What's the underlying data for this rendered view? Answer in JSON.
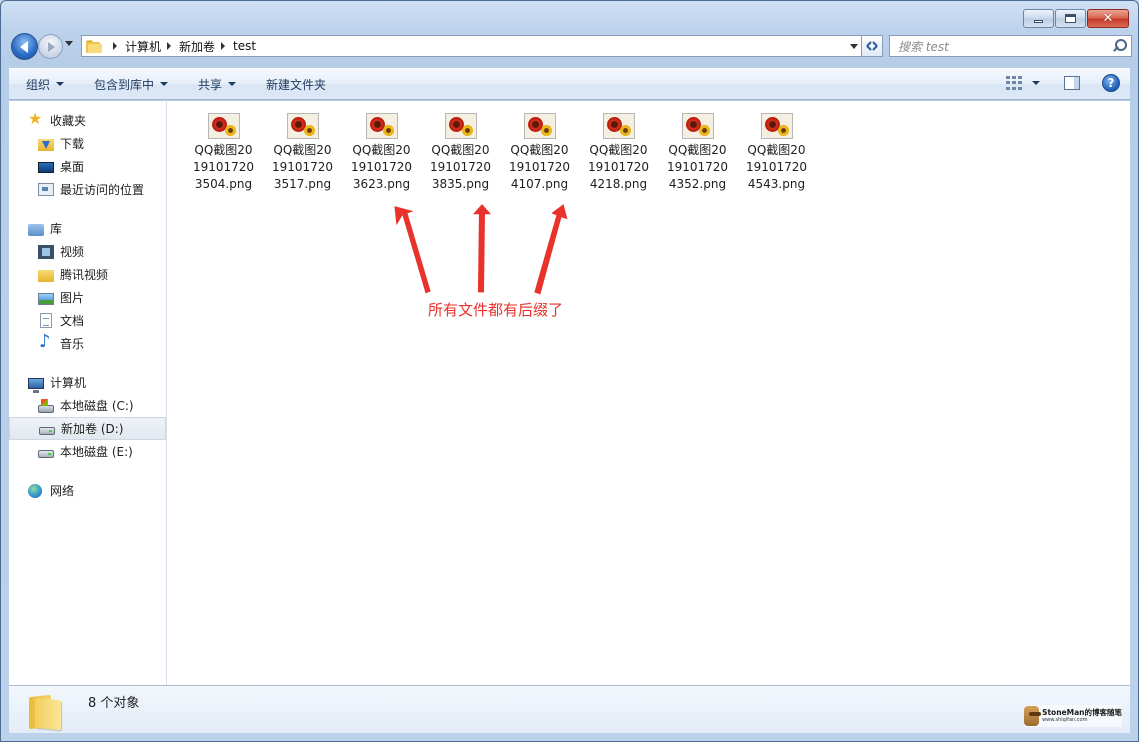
{
  "window": {
    "caption_buttons": {
      "close": "✕"
    }
  },
  "address_bar": {
    "breadcrumbs": [
      "计算机",
      "新加卷",
      "test"
    ]
  },
  "search": {
    "placeholder": "搜索 test"
  },
  "toolbar": {
    "organize": "组织",
    "include_in_library": "包含到库中",
    "share": "共享",
    "new_folder": "新建文件夹",
    "help": "?"
  },
  "nav": {
    "favorites": {
      "label": "收藏夹",
      "items": [
        "下载",
        "桌面",
        "最近访问的位置"
      ]
    },
    "libraries": {
      "label": "库",
      "items": [
        "视频",
        "腾讯视频",
        "图片",
        "文档",
        "音乐"
      ]
    },
    "computer": {
      "label": "计算机",
      "items": [
        "本地磁盘 (C:)",
        "新加卷 (D:)",
        "本地磁盘 (E:)"
      ]
    },
    "network": {
      "label": "网络"
    }
  },
  "files": [
    {
      "name": "QQ截图20191017203504.png"
    },
    {
      "name": "QQ截图20191017203517.png"
    },
    {
      "name": "QQ截图20191017203623.png"
    },
    {
      "name": "QQ截图20191017203835.png"
    },
    {
      "name": "QQ截图20191017204107.png"
    },
    {
      "name": "QQ截图20191017204218.png"
    },
    {
      "name": "QQ截图20191017204352.png"
    },
    {
      "name": "QQ截图20191017204543.png"
    }
  ],
  "annotation": {
    "text": "所有文件都有后缀了",
    "color": "#e8322b"
  },
  "status": {
    "count": "8 个对象"
  },
  "watermark": {
    "title": "StoneMan的博客随笔",
    "url": "www.shiqifan.com"
  },
  "colors": {
    "selected_bg": "#e2e8ef",
    "accent": "#1e395b"
  }
}
